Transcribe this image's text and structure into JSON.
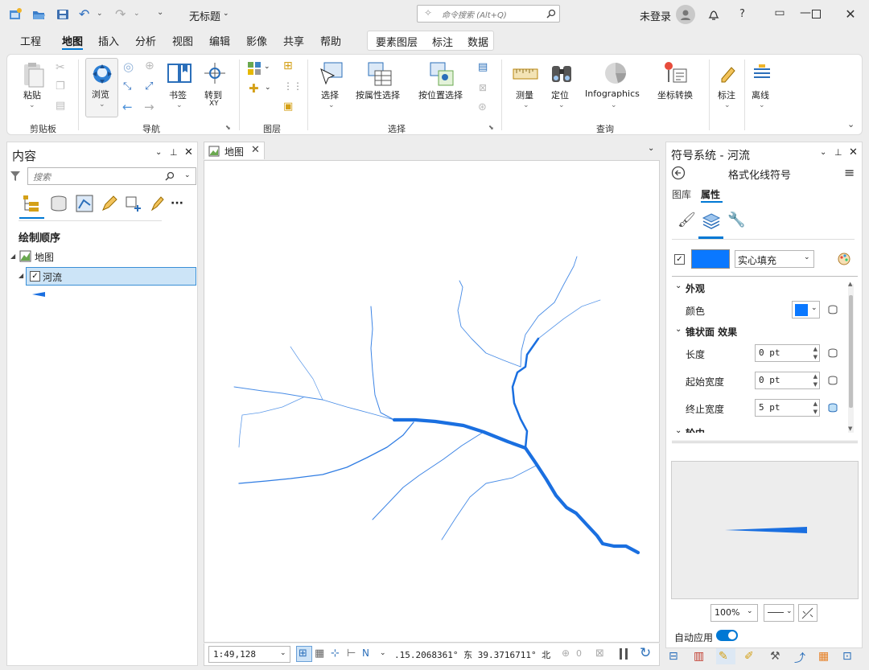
{
  "app": {
    "doc_title": "无标题",
    "search_placeholder": "命令搜索 (Alt+Q)",
    "user": "未登录",
    "help": "?"
  },
  "colors": {
    "accent": "#0078d4",
    "river": "#1a6fe0",
    "fill_swatch": "#0a78ff"
  },
  "menu": {
    "items": [
      "工程",
      "地图",
      "插入",
      "分析",
      "视图",
      "编辑",
      "影像",
      "共享",
      "帮助"
    ],
    "active": "地图",
    "context_tabs": [
      "要素图层",
      "标注",
      "数据"
    ]
  },
  "ribbon": {
    "clipboard": {
      "paste": "粘贴",
      "group": "剪贴板"
    },
    "navigate": {
      "explore": "浏览",
      "bookmarks": "书签",
      "goto": "转到",
      "goto_sub": "XY",
      "group": "导航"
    },
    "layer": {
      "group": "图层"
    },
    "selection": {
      "select": "选择",
      "by_attr": "按属性选择",
      "by_loc": "按位置选择",
      "group": "选择"
    },
    "inquiry": {
      "measure": "测量",
      "locate": "定位",
      "infographics": "Infographics",
      "convert": "坐标转换",
      "group": "查询"
    },
    "labeling": {
      "label": "标注"
    },
    "offline": {
      "offline": "离线"
    }
  },
  "contents": {
    "title": "内容",
    "search_placeholder": "搜索",
    "section": "绘制顺序",
    "map_item": "地图",
    "layer_item": "河流"
  },
  "map": {
    "tab": "地图",
    "scale": "1:49,128",
    "coords": ".15.2068361° 东  39.3716711° 北",
    "sel_count": "0"
  },
  "symbology": {
    "title": "符号系统 - 河流",
    "subtitle": "格式化线符号",
    "tabs": [
      "图库",
      "属性"
    ],
    "active_tab": "属性",
    "fill_type": "实心填充",
    "sections": {
      "appearance": "外观",
      "tapered": "锥状面 效果",
      "next": "轮中"
    },
    "color_label": "颜色",
    "length_label": "长度",
    "length_value": "0 pt",
    "start_label": "起始宽度",
    "start_value": "0 pt",
    "end_label": "终止宽度",
    "end_value": "5 pt",
    "zoom": "100%",
    "auto_apply": "自动应用"
  }
}
